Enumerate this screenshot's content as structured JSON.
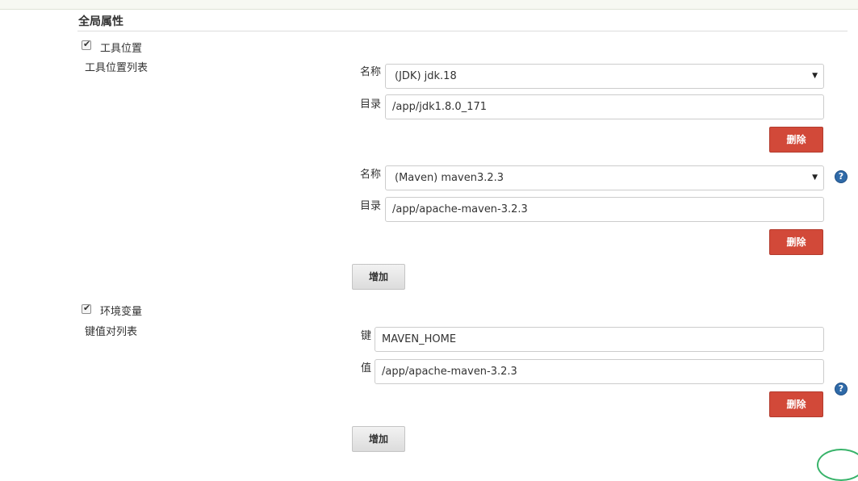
{
  "section": {
    "title": "全局属性"
  },
  "tool_locations": {
    "checkbox_label": "工具位置",
    "list_label": "工具位置列表",
    "entries": [
      {
        "name_label": "名称",
        "name_value": "(JDK) jdk.18",
        "dir_label": "目录",
        "dir_value": "/app/jdk1.8.0_171",
        "delete_label": "删除"
      },
      {
        "name_label": "名称",
        "name_value": "(Maven) maven3.2.3",
        "dir_label": "目录",
        "dir_value": "/app/apache-maven-3.2.3",
        "delete_label": "删除"
      }
    ],
    "add_label": "增加"
  },
  "env_vars": {
    "checkbox_label": "环境变量",
    "list_label": "键值对列表",
    "entries": [
      {
        "key_label": "键",
        "key_value": "MAVEN_HOME",
        "value_label": "值",
        "value_value": "/app/apache-maven-3.2.3",
        "delete_label": "删除"
      }
    ],
    "add_label": "增加"
  },
  "icons": {
    "help": "?",
    "dropdown": "▼"
  },
  "colors": {
    "delete_button": "#d24939",
    "help_icon": "#2f6aa8",
    "badge_border": "#38b36a"
  }
}
